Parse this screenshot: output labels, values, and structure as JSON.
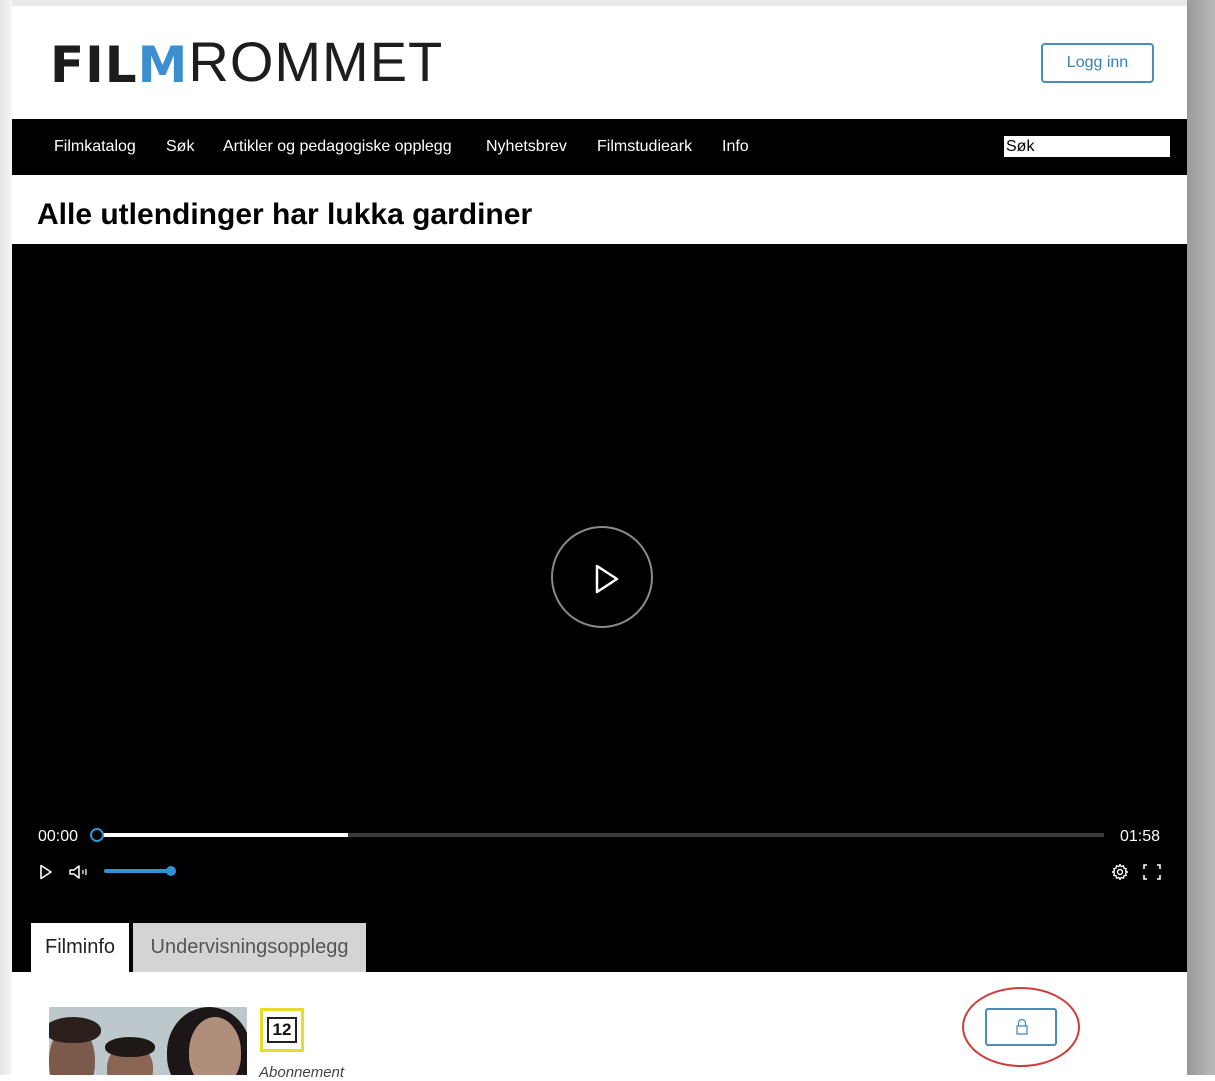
{
  "header": {
    "logo_bold_pre": "FIL",
    "logo_bold_accent": "M",
    "logo_light": "ROMMET",
    "login_label": "Logg inn"
  },
  "nav": {
    "items": [
      "Filmkatalog",
      "Søk",
      "Artikler og pedagogiske opplegg",
      "Nyhetsbrev",
      "Filmstudieark",
      "Info"
    ],
    "search_value": "Søk"
  },
  "film": {
    "title": "Alle utlendinger har lukka gardiner"
  },
  "player": {
    "current_time": "00:00",
    "duration": "01:58",
    "buffered_fraction": 0.25,
    "volume_fraction": 1.0,
    "icons": [
      "play-icon",
      "volume-icon",
      "settings-icon",
      "fullscreen-icon"
    ]
  },
  "tabs": {
    "active": "Filminfo",
    "inactive": "Undervisningsopplegg"
  },
  "filminfo": {
    "age_rating": "12",
    "subscription_label": "Abonnement"
  },
  "colors": {
    "accent": "#3d8ed0",
    "player_accent": "#2f92d6",
    "navbar": "#000000",
    "age_badge_border": "#e6dd2a",
    "highlight": "#d03a3a"
  }
}
